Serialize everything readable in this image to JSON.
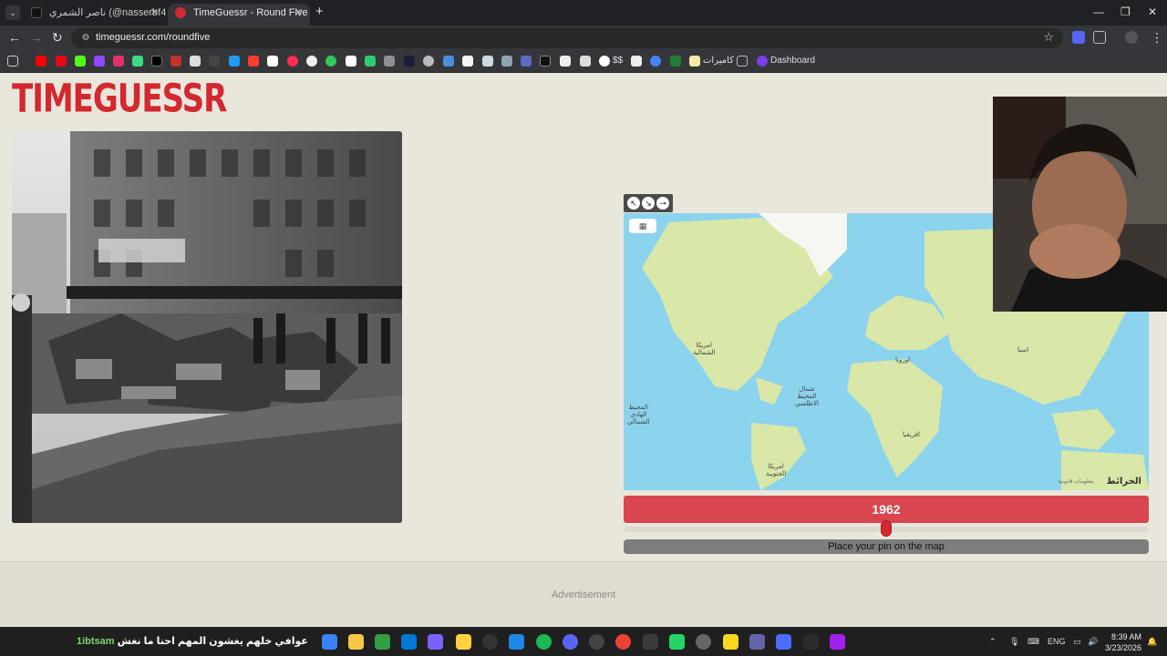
{
  "browser": {
    "tabs": [
      {
        "title": "ناصر الشمري (@nasserbf4) |",
        "active": false
      },
      {
        "title": "TimeGuessr - Round Five",
        "active": true
      }
    ],
    "url": "timeguessr.com/roundfive",
    "new_tab_label": "+",
    "bookmarks": {
      "cameras_label": "كاميرات",
      "dollar_label": "$$",
      "dashboard_label": "Dashboard"
    }
  },
  "page": {
    "logo_text": "TIMEGUESSR",
    "map": {
      "labels": {
        "north_america": "امريكا\nالشمالية",
        "europe": "اوروبا",
        "asia": "اسيا",
        "africa": "افريقيا",
        "south_america": "امريكا\nالجنوبية",
        "north_atlantic": "شمال\nالمحيط\nالاطلسي",
        "north_pacific": "المحيط\nالهادي\nالشمالي"
      },
      "attribution": "الخرائط",
      "legal": "معلومات قانونية"
    },
    "year_value": "1962",
    "slider_fraction": 0.5,
    "pin_prompt": "Place your pin on the map",
    "ad_label": "Advertisement"
  },
  "taskbar": {
    "ticker_name": "1ibtsam",
    "ticker_text": "عوافي خلهم يغشون المهم احنا ما نغش",
    "lang": "ENG",
    "time": "8:39 AM",
    "date": "3/23/2026"
  },
  "colors": {
    "brand_red": "#d3282f",
    "page_bg": "#e9e7dc",
    "ocean": "#8cd3ee",
    "land": "#d9e8a8"
  }
}
